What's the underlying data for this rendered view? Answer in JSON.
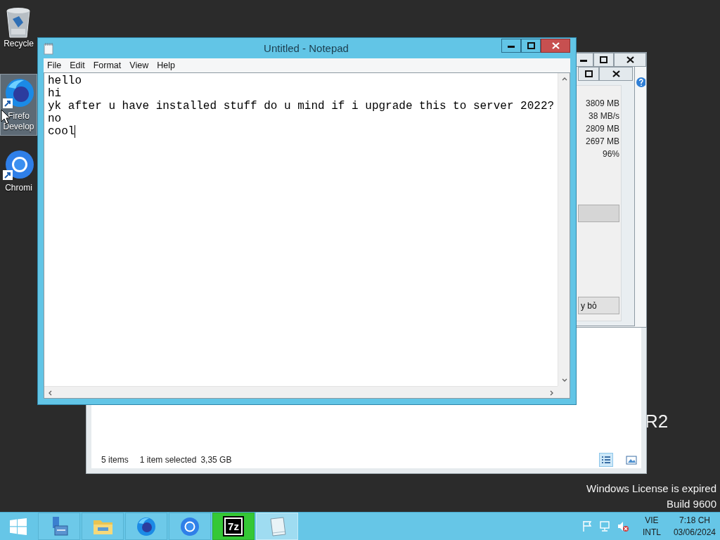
{
  "desktop_icons": [
    {
      "kind": "recycle_bin",
      "label_lines": [
        "Recycle"
      ],
      "selected": false
    },
    {
      "kind": "firefox_developer",
      "label_lines": [
        "Firefo",
        "Develop"
      ],
      "selected": true
    },
    {
      "kind": "chromium",
      "label_lines": [
        "Chromi"
      ],
      "selected": false
    }
  ],
  "desktop_branding": {
    "edition_fragment": "R2",
    "lines": [
      "Windows License is expired",
      "Build 9600"
    ]
  },
  "explorer_window": {
    "status_items": "5 items",
    "status_selection": "1 item selected",
    "status_size": "3,35 GB",
    "view_buttons": [
      {
        "kind": "details",
        "selected": true
      },
      {
        "kind": "large_icons",
        "selected": false
      }
    ]
  },
  "copy_dialog": {
    "values": [
      "3809 MB",
      "38 MB/s",
      "2809 MB",
      "2697 MB",
      "96%"
    ],
    "cancel_button": "y bỏ"
  },
  "notepad": {
    "title": "Untitled - Notepad",
    "menu": [
      "File",
      "Edit",
      "Format",
      "View",
      "Help"
    ],
    "lines": [
      "hello",
      "hi",
      "yk after u have installed stuff do u mind if i upgrade this to server 2022?",
      "no",
      "cool"
    ],
    "focused": true
  },
  "taskbar": {
    "apps": [
      {
        "kind": "server_manager",
        "active": false,
        "flashing": false
      },
      {
        "kind": "file_explorer",
        "active": false,
        "flashing": false
      },
      {
        "kind": "firefox_developer",
        "active": false,
        "flashing": false
      },
      {
        "kind": "chromium",
        "active": false,
        "flashing": false
      },
      {
        "kind": "archiver",
        "label": "7z",
        "active": false,
        "flashing": true
      },
      {
        "kind": "notepad",
        "active": true,
        "flashing": false
      }
    ],
    "tray_icons": [
      {
        "kind": "flag"
      },
      {
        "kind": "network"
      },
      {
        "kind": "speaker_muted"
      }
    ],
    "language": [
      "VIE",
      "INTL"
    ],
    "time": "7:18 CH",
    "date": "03/06/2024"
  }
}
